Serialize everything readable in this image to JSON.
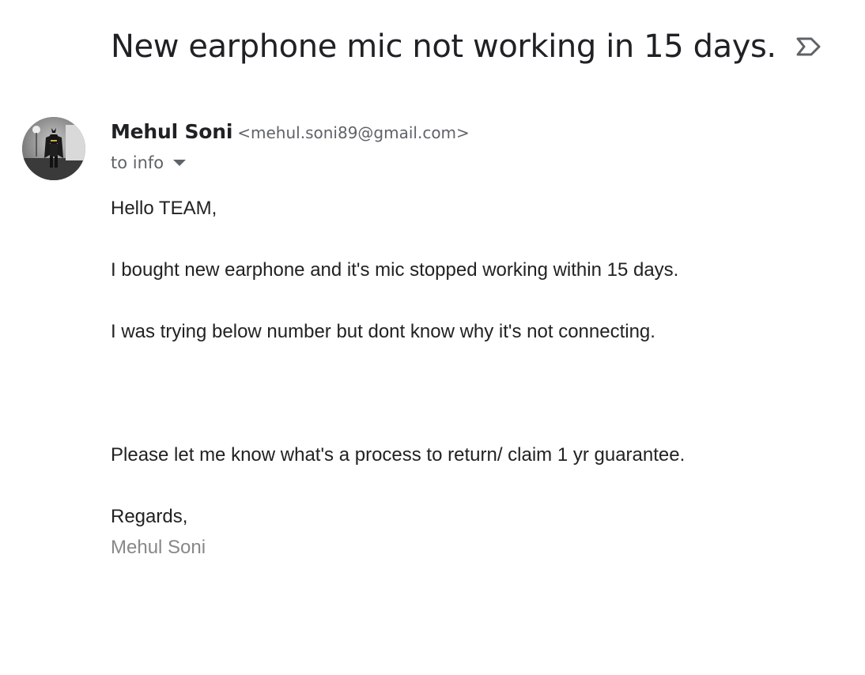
{
  "email": {
    "subject": "New earphone mic not working in 15 days.",
    "label_icon": "label-icon",
    "sender": {
      "name": "Mehul Soni",
      "email": "<mehul.soni89@gmail.com>",
      "avatar": "avatar"
    },
    "recipient_text": "to info",
    "body": {
      "greeting": "Hello TEAM,",
      "paragraph1": "I bought new earphone and it's mic stopped working within 15 days.",
      "paragraph2": "I was trying below number but dont know why it's not connecting.",
      "paragraph3": "Please let me know what's a process to return/ claim 1 yr guarantee.",
      "closing": "Regards,",
      "signature": "Mehul Soni"
    }
  },
  "colors": {
    "text_primary": "#202124",
    "text_secondary": "#5f6368",
    "signature": "#888888"
  }
}
